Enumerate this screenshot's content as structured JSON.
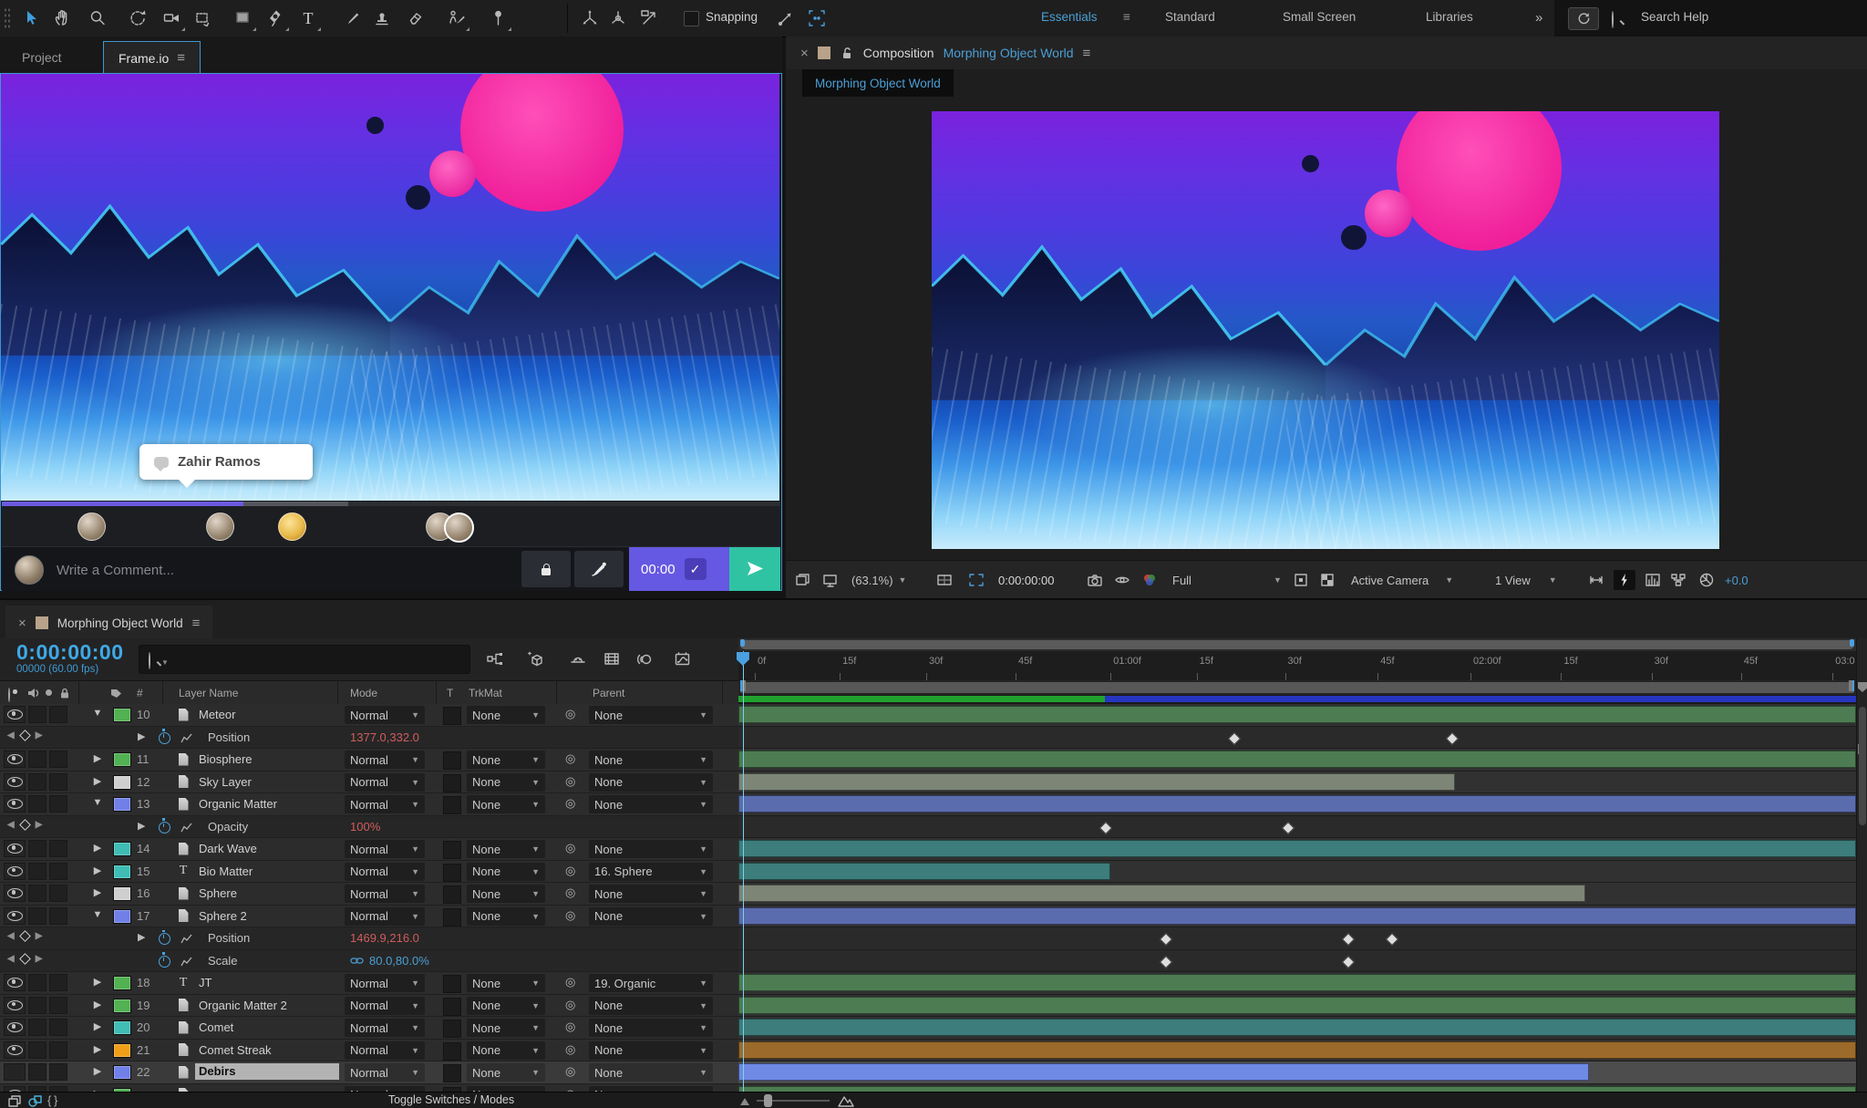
{
  "toolbar": {
    "tools": [
      "selection",
      "hand",
      "zoom",
      "rotation",
      "camera",
      "pan-behind",
      "rectangle",
      "pen",
      "type",
      "brush",
      "clone-stamp",
      "eraser",
      "roto-brush",
      "puppet-pin"
    ],
    "axis_modes": [
      "local-axis",
      "world-axis",
      "view-axis"
    ],
    "snapping_label": "Snapping",
    "workspaces": [
      "Essentials",
      "Standard",
      "Small Screen",
      "Libraries"
    ],
    "overflow_glyph": "»",
    "search_help": "Search Help"
  },
  "frameio": {
    "tabs": [
      "Project",
      "Frame.io"
    ],
    "active_tab": "Frame.io",
    "comment_tooltip": "Zahir Ramos",
    "comment_placeholder": "Write a Comment...",
    "comment_time": "00:00",
    "check_glyph": "✓",
    "progress": {
      "played": 0.31,
      "buffered": 0.445
    },
    "avatars": [
      {
        "x": 0.097,
        "kind": "photo"
      },
      {
        "x": 0.262,
        "kind": "photo"
      },
      {
        "x": 0.355,
        "kind": "gold"
      },
      {
        "x": 0.545,
        "kind": "photo"
      },
      {
        "x": 0.568,
        "kind": "photo-ring"
      }
    ],
    "colors": {
      "comment_purple": "#6558e2",
      "send_teal": "#2fc3a4",
      "progress_purple": "#6b5ae0"
    }
  },
  "composition": {
    "panel_label": "Composition",
    "name": "Morphing Object World",
    "tab": "Morphing Object World",
    "zoom": "(63.1%)",
    "timecode": "0:00:00:00",
    "resolution": "Full",
    "view_mode": "Active Camera",
    "view_count": "1 View",
    "exposure": "+0.0"
  },
  "timeline": {
    "tab": "Morphing Object World",
    "timecode": "0:00:00:00",
    "frame_info": "00000 (60.00 fps)",
    "toggle_label": "Toggle Switches / Modes",
    "columns": {
      "number": "#",
      "layer_name": "Layer Name",
      "mode": "Mode",
      "t": "T",
      "trkmat": "TrkMat",
      "parent": "Parent"
    },
    "ruler_ticks": [
      {
        "label": "0f",
        "x": 0.0147
      },
      {
        "label": "15f",
        "x": 0.0906
      },
      {
        "label": "30f",
        "x": 0.168
      },
      {
        "label": "45f",
        "x": 0.248
      },
      {
        "label": "01:00f",
        "x": 0.333
      },
      {
        "label": "15f",
        "x": 0.41
      },
      {
        "label": "30f",
        "x": 0.489
      },
      {
        "label": "45f",
        "x": 0.572
      },
      {
        "label": "02:00f",
        "x": 0.655
      },
      {
        "label": "15f",
        "x": 0.736
      },
      {
        "label": "30f",
        "x": 0.817
      },
      {
        "label": "45f",
        "x": 0.897
      },
      {
        "label": "03:0",
        "x": 0.979
      }
    ],
    "playhead_x": 0.004,
    "cache": {
      "green_end": 0.328,
      "green": "#21a22e",
      "blue": "#2636c0"
    },
    "rows": [
      {
        "type": "layer",
        "num": "10",
        "name": "Meteor",
        "icon": "footage",
        "swatch": "#52b152",
        "expanded": true,
        "eye": true,
        "mode": "Normal",
        "trkmat": "None",
        "parent": "None",
        "bar_color": "#4d7c52",
        "bar_end": 1
      },
      {
        "type": "prop",
        "name": "Position",
        "value": "1377.0,332.0",
        "value_style": "red",
        "has_expand": true,
        "keys": [
          0.443,
          0.638
        ]
      },
      {
        "type": "layer",
        "num": "11",
        "name": "Biosphere",
        "icon": "footage",
        "swatch": "#52b152",
        "expanded": false,
        "eye": true,
        "mode": "Normal",
        "trkmat": "None",
        "parent": "None",
        "bar_color": "#4d7c52",
        "bar_end": 1
      },
      {
        "type": "layer",
        "num": "12",
        "name": "Sky Layer",
        "icon": "footage",
        "swatch": "#cfcfcf",
        "expanded": false,
        "eye": true,
        "mode": "Normal",
        "trkmat": "None",
        "parent": "None",
        "bar_color": "#7d8577",
        "bar_end": 0.641
      },
      {
        "type": "layer",
        "num": "13",
        "name": "Organic Matter",
        "icon": "footage",
        "swatch": "#7080e8",
        "expanded": true,
        "eye": true,
        "mode": "Normal",
        "trkmat": "None",
        "parent": "None",
        "bar_color": "#5b6cae",
        "bar_end": 1
      },
      {
        "type": "prop",
        "name": "Opacity",
        "value": "100%",
        "value_style": "red",
        "has_expand": true,
        "keys": [
          0.328,
          0.491
        ]
      },
      {
        "type": "layer",
        "num": "14",
        "name": "Dark Wave",
        "icon": "footage",
        "swatch": "#3fbdb4",
        "expanded": false,
        "eye": true,
        "mode": "Normal",
        "trkmat": "None",
        "parent": "None",
        "bar_color": "#3d7d7b",
        "bar_end": 1
      },
      {
        "type": "layer",
        "num": "15",
        "name": "Bio Matter",
        "icon": "text",
        "swatch": "#3fbdb4",
        "expanded": false,
        "eye": true,
        "mode": "Normal",
        "trkmat": "None",
        "parent": "16. Sphere",
        "bar_color": "#3d7d7b",
        "bar_end": 0.333
      },
      {
        "type": "layer",
        "num": "16",
        "name": "Sphere",
        "icon": "footage",
        "swatch": "#cfcfcf",
        "expanded": false,
        "eye": true,
        "mode": "Normal",
        "trkmat": "None",
        "parent": "None",
        "bar_color": "#7d8577",
        "bar_end": 0.758
      },
      {
        "type": "layer",
        "num": "17",
        "name": "Sphere 2",
        "icon": "footage",
        "swatch": "#7080e8",
        "expanded": true,
        "eye": true,
        "mode": "Normal",
        "trkmat": "None",
        "parent": "None",
        "bar_color": "#5b6cae",
        "bar_end": 1
      },
      {
        "type": "prop",
        "name": "Position",
        "value": "1469.9,216.0",
        "value_style": "red",
        "has_expand": true,
        "keys": [
          0.382,
          0.545,
          0.584
        ]
      },
      {
        "type": "prop",
        "name": "Scale",
        "value": "80.0,80.0%",
        "value_style": "blue",
        "linked": true,
        "has_expand": false,
        "keys": [
          0.382,
          0.545
        ]
      },
      {
        "type": "layer",
        "num": "18",
        "name": "JT",
        "icon": "text",
        "swatch": "#52b152",
        "expanded": false,
        "eye": true,
        "mode": "Normal",
        "trkmat": "None",
        "parent": "19. Organic",
        "bar_color": "#4d7c52",
        "bar_end": 1
      },
      {
        "type": "layer",
        "num": "19",
        "name": "Organic Matter 2",
        "icon": "footage",
        "swatch": "#52b152",
        "expanded": false,
        "eye": true,
        "mode": "Normal",
        "trkmat": "None",
        "parent": "None",
        "bar_color": "#4d7c52",
        "bar_end": 1
      },
      {
        "type": "layer",
        "num": "20",
        "name": "Comet",
        "icon": "footage",
        "swatch": "#3fbdb4",
        "expanded": false,
        "eye": true,
        "mode": "Normal",
        "trkmat": "None",
        "parent": "None",
        "bar_color": "#3d7d7b",
        "bar_end": 1
      },
      {
        "type": "layer",
        "num": "21",
        "name": "Comet Streak",
        "icon": "footage",
        "swatch": "#f09f18",
        "expanded": false,
        "eye": true,
        "mode": "Normal",
        "trkmat": "None",
        "parent": "None",
        "bar_color": "#9c6b2b",
        "bar_end": 1
      },
      {
        "type": "layer",
        "num": "22",
        "name": "Debirs",
        "icon": "footage",
        "swatch": "#7080e8",
        "expanded": false,
        "eye": false,
        "selected": true,
        "mode": "Normal",
        "trkmat": "None",
        "parent": "None",
        "bar_color": "#6e8ae4",
        "bar_end": 0.761
      },
      {
        "type": "layer",
        "num": "",
        "name": "",
        "icon": "footage",
        "swatch": "#52b152",
        "expanded": false,
        "eye": true,
        "mode": "Normal",
        "trkmat": "None",
        "parent": "None",
        "bar_color": "#4d7c52",
        "bar_end": 1,
        "partial": true
      }
    ]
  },
  "colors": {
    "accent_blue": "#4b9fd5",
    "timecode_blue": "#3fa9e8",
    "value_red": "#d25c5c",
    "tool_selected": "#3e9fe0"
  }
}
